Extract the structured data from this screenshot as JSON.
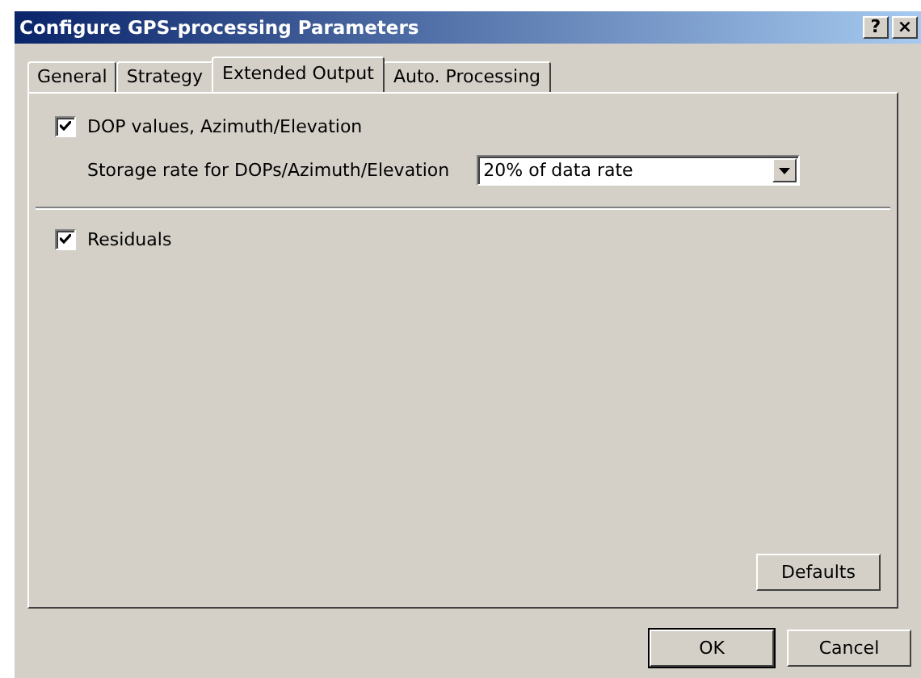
{
  "window": {
    "title": "Configure GPS-processing Parameters",
    "title_buttons": [
      "?",
      "×"
    ]
  },
  "tabs": [
    {
      "label": "General",
      "selected": false
    },
    {
      "label": "Strategy",
      "selected": false
    },
    {
      "label": "Extended Output",
      "selected": true
    },
    {
      "label": "Auto. Processing",
      "selected": false
    }
  ],
  "dop": {
    "label": "DOP values, Azimuth/Elevation",
    "checked": true,
    "storage_rate": {
      "label": "Storage rate for DOPs/Azimuth/Elevation",
      "value": "20% of data rate"
    }
  },
  "residuals": {
    "label": "Residuals",
    "checked": true
  },
  "defaults_button": "Defaults",
  "buttons": [
    {
      "label": "OK",
      "default": true
    },
    {
      "label": "Cancel",
      "default": false
    }
  ]
}
